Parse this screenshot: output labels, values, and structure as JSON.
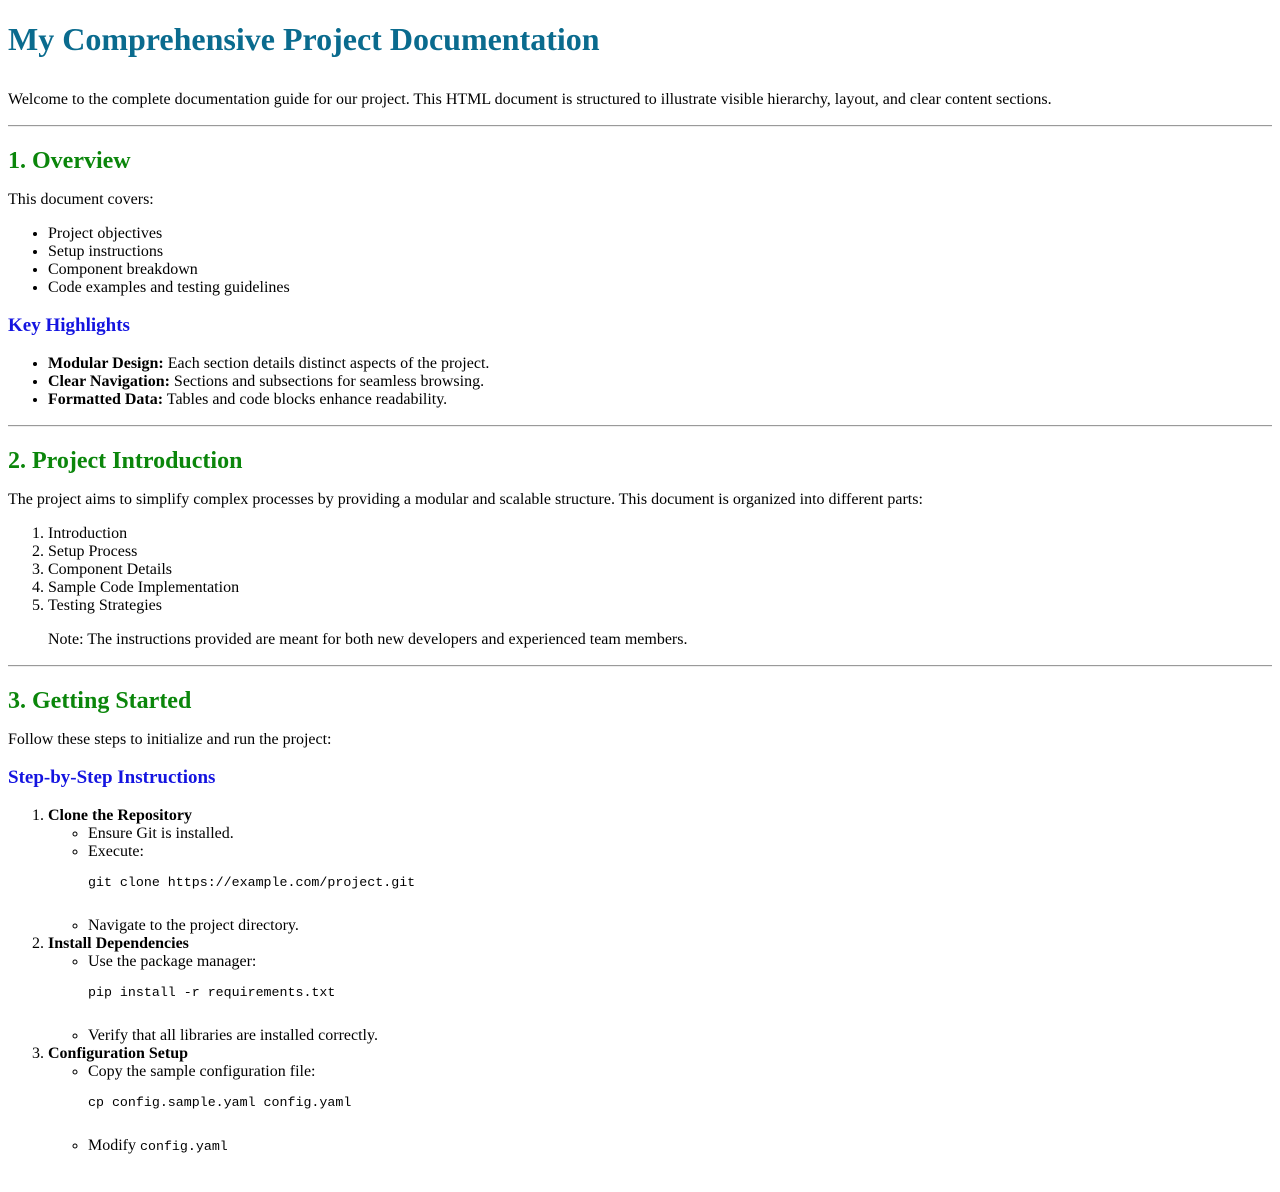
{
  "title": "My Comprehensive Project Documentation",
  "intro": "Welcome to the complete documentation guide for our project. This HTML document is structured to illustrate visible hierarchy, layout, and clear content sections.",
  "overview": {
    "heading": "1. Overview",
    "lead": "This document covers:",
    "items": [
      "Project objectives",
      "Setup instructions",
      "Component breakdown",
      "Code examples and testing guidelines"
    ],
    "highlights_heading": "Key Highlights",
    "highlights": [
      {
        "term": "Modular Design:",
        "text": " Each section details distinct aspects of the project."
      },
      {
        "term": "Clear Navigation:",
        "text": " Sections and subsections for seamless browsing."
      },
      {
        "term": "Formatted Data:",
        "text": " Tables and code blocks enhance readability."
      }
    ]
  },
  "introduction": {
    "heading": "2. Project Introduction",
    "lead": "The project aims to simplify complex processes by providing a modular and scalable structure. This document is organized into different parts:",
    "parts": [
      "Introduction",
      "Setup Process",
      "Component Details",
      "Sample Code Implementation",
      "Testing Strategies"
    ],
    "note": "Note: The instructions provided are meant for both new developers and experienced team members."
  },
  "getting_started": {
    "heading": "3. Getting Started",
    "lead": "Follow these steps to initialize and run the project:",
    "steps_heading": "Step-by-Step Instructions",
    "steps": [
      {
        "title": "Clone the Repository",
        "sub1": "Ensure Git is installed.",
        "sub2": "Execute:",
        "code": "git clone https://example.com/project.git",
        "sub3": "Navigate to the project directory."
      },
      {
        "title": "Install Dependencies",
        "sub1": "Use the package manager:",
        "code": "pip install -r requirements.txt",
        "sub2": "Verify that all libraries are installed correctly."
      },
      {
        "title": "Configuration Setup",
        "sub1": "Copy the sample configuration file:",
        "code": "cp config.sample.yaml config.yaml",
        "sub2_prefix": "Modify ",
        "sub2_code": "config.yaml"
      }
    ]
  }
}
